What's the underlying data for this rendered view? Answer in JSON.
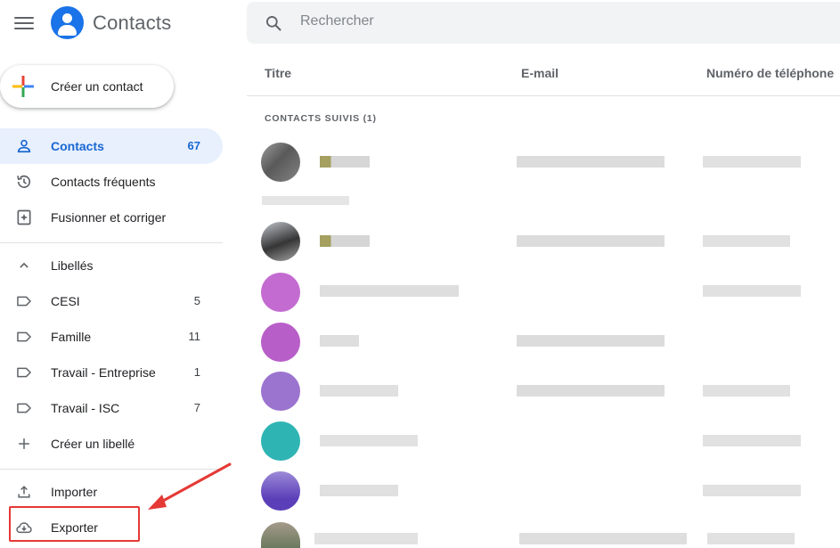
{
  "header": {
    "app_title": "Contacts",
    "search_placeholder": "Rechercher",
    "menu_icon": "hamburger-menu-icon",
    "logo_icon": "contacts-logo-icon",
    "search_icon": "search-icon"
  },
  "create_contact": {
    "label": "Créer un contact",
    "icon": "plus-colored-icon"
  },
  "sidebar": {
    "main_items": [
      {
        "label": "Contacts",
        "count": "67",
        "icon": "person-icon",
        "active": true
      },
      {
        "label": "Contacts fréquents",
        "count": "",
        "icon": "history-icon"
      },
      {
        "label": "Fusionner et corriger",
        "count": "",
        "icon": "merge-icon"
      }
    ],
    "labels_header": {
      "label": "Libellés",
      "icon": "chevron-up-icon"
    },
    "labels": [
      {
        "label": "CESI",
        "count": "5",
        "icon": "label-icon"
      },
      {
        "label": "Famille",
        "count": "11",
        "icon": "label-icon"
      },
      {
        "label": "Travail - Entreprise",
        "count": "1",
        "icon": "label-icon"
      },
      {
        "label": "Travail - ISC",
        "count": "7",
        "icon": "label-icon"
      }
    ],
    "create_label": {
      "label": "Créer un libellé",
      "icon": "plus-icon"
    },
    "import": {
      "label": "Importer",
      "icon": "upload-icon"
    },
    "export": {
      "label": "Exporter",
      "icon": "cloud-download-icon"
    }
  },
  "table": {
    "columns": [
      "Titre",
      "E-mail",
      "Numéro de téléphone"
    ],
    "section_label": "CONTACTS SUIVIS (1)"
  },
  "colors": {
    "accent": "#1967d2",
    "active_bg": "#e8f0fe",
    "highlight": "#e53935"
  }
}
